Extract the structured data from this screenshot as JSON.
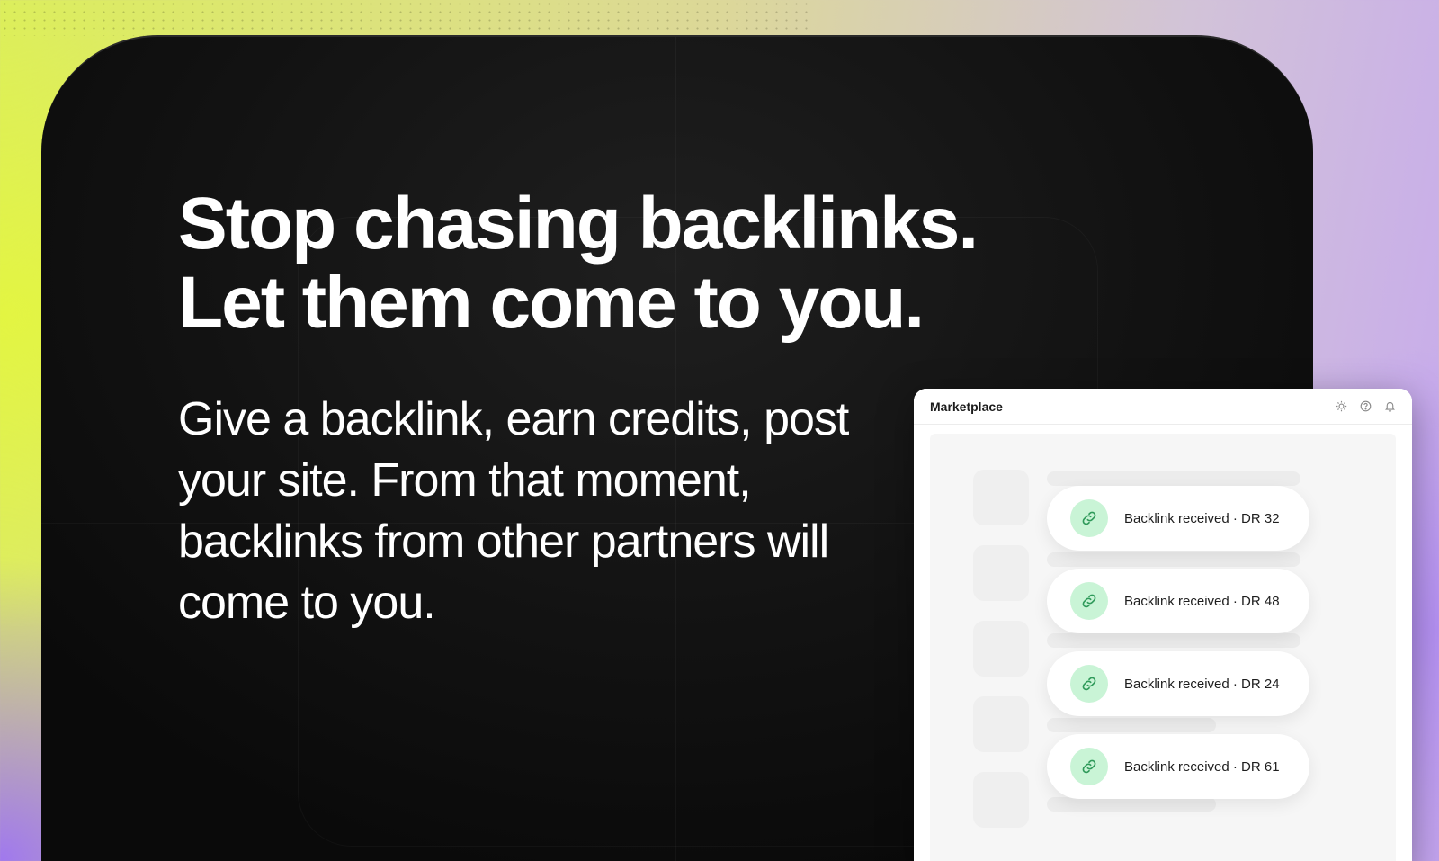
{
  "hero": {
    "headline_line1": "Stop chasing backlinks.",
    "headline_line2": "Let them come to you.",
    "subtext": "Give a backlink, earn credits, post your site. From that moment, backlinks from other partners will come to you."
  },
  "panel": {
    "title": "Marketplace",
    "icons": [
      "sun-icon",
      "help-icon",
      "bell-icon"
    ],
    "notifications": [
      {
        "text": "Backlink received · DR 32",
        "icon": "link-icon"
      },
      {
        "text": "Backlink received · DR 48",
        "icon": "link-icon"
      },
      {
        "text": "Backlink received · DR 24",
        "icon": "link-icon"
      },
      {
        "text": "Backlink received · DR 61",
        "icon": "link-icon"
      }
    ]
  },
  "colors": {
    "card_bg": "#121212",
    "headline": "#ffffff",
    "accent_green_bg": "#c9f4d6",
    "accent_green_icon": "#2f9a5a",
    "bg_yellow": "#e3f542",
    "bg_purple": "#b490f2"
  }
}
